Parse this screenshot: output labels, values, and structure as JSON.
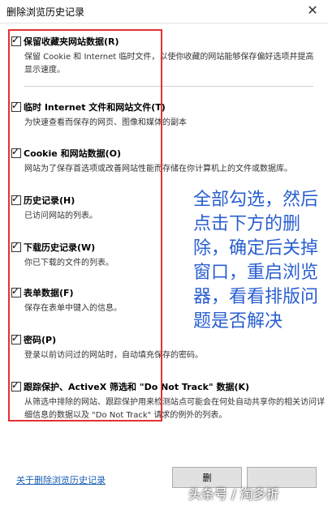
{
  "window": {
    "title": "删除浏览历史记录",
    "close_glyph": "✕"
  },
  "items": [
    {
      "label": "保留收藏夹网站数据(R)",
      "checked": true,
      "desc": "保留 Cookie 和 Internet 临时文件，以使你收藏的网站能够保存偏好选项并提高显示速度。"
    },
    {
      "label": "临时 Internet 文件和网站文件(T)",
      "checked": true,
      "desc": "为快速查看而保存的网页、图像和媒体的副本"
    },
    {
      "label": "Cookie 和网站数据(O)",
      "checked": true,
      "desc": "网站为了保存首选项或改善网站性能而存储在你计算机上的文件或数据库。"
    },
    {
      "label": "历史记录(H)",
      "checked": true,
      "desc": "已访问网站的列表。"
    },
    {
      "label": "下载历史记录(W)",
      "checked": true,
      "desc": "你已下载的文件的列表。"
    },
    {
      "label": "表单数据(F)",
      "checked": true,
      "desc": "保存在表单中键入的信息。"
    },
    {
      "label": "密码(P)",
      "checked": true,
      "desc": "登录以前访问过的网站时，自动填充保存的密码。"
    },
    {
      "label": "跟踪保护、ActiveX 筛选和 \"Do Not Track\" 数据(K)",
      "checked": true,
      "desc": "从筛选中排除的网站、跟踪保护用来检测站点可能会在何处自动共享你的相关访问详细信息的数据以及 \"Do Not Track\" 请求的例外的列表。"
    }
  ],
  "annotation": {
    "lines": [
      "全部勾选，然后",
      "点击下方的删",
      "除，确定后关掉",
      "窗口，重启浏览",
      "器，看看排版问",
      "题是否解决"
    ]
  },
  "footer": {
    "link": "关于删除浏览历史记录",
    "delete_button": "删",
    "cancel_button": ""
  },
  "watermark": "头条号 / 淘多折",
  "colors": {
    "highlight_box": "#e53030",
    "annotation_text": "#2a5fd0",
    "link": "#1a5fb4"
  }
}
